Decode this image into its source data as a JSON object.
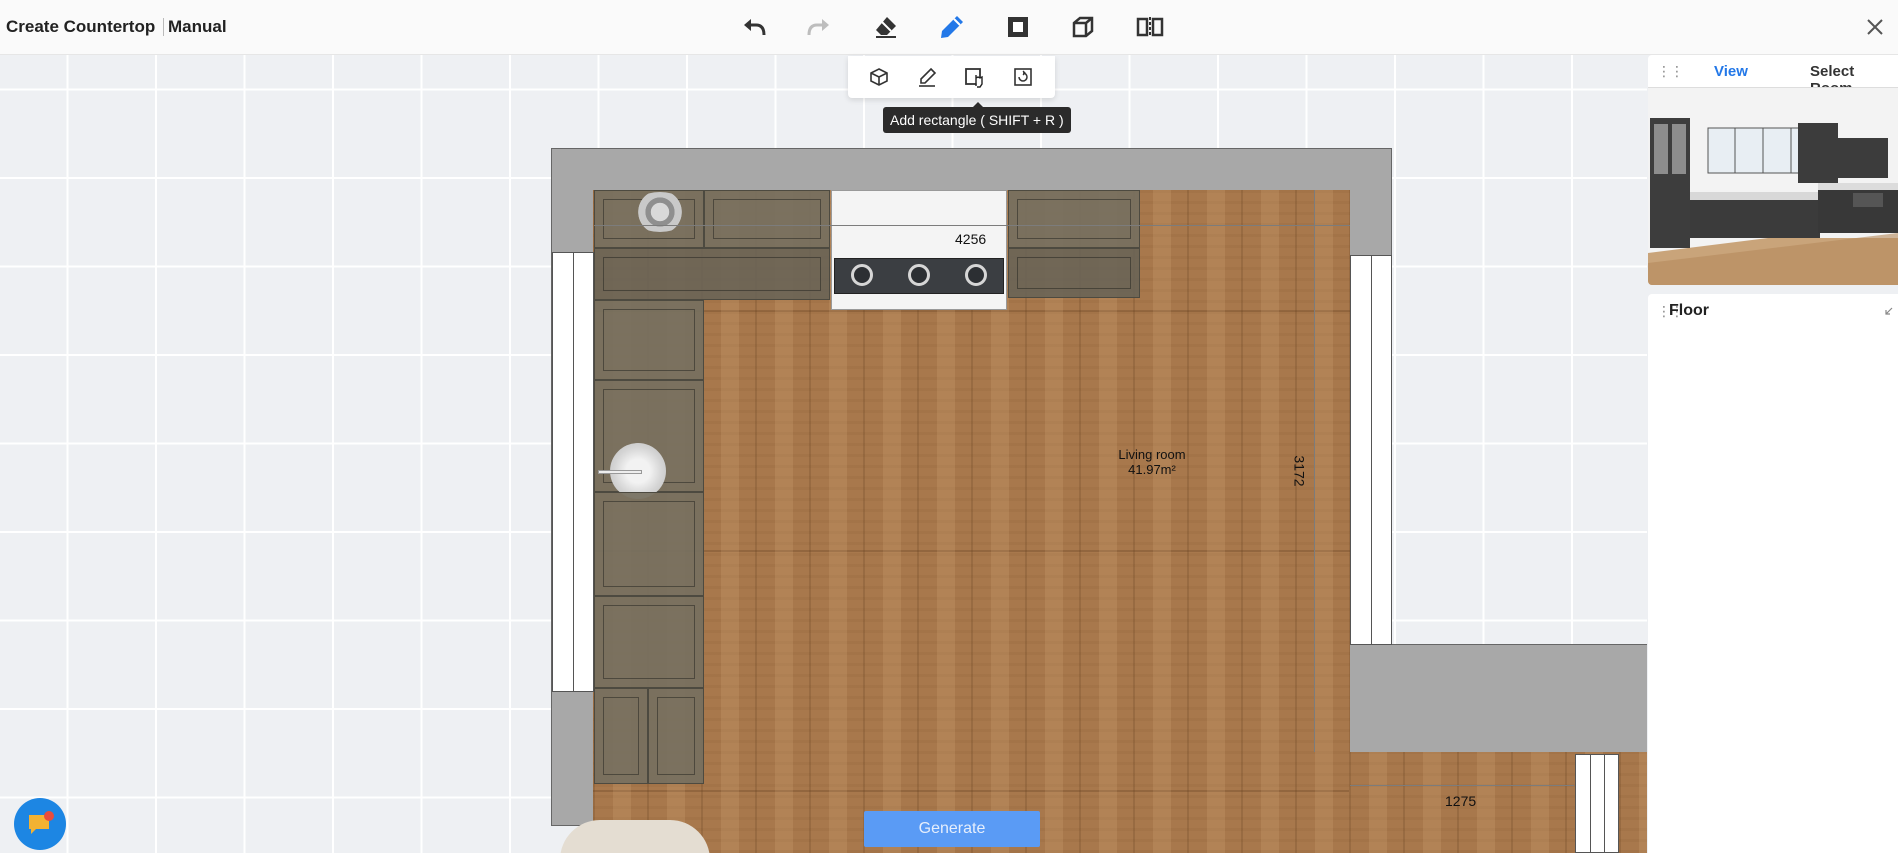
{
  "header": {
    "title": "Create Countertop",
    "mode": "Manual"
  },
  "toolbar": {
    "tools": [
      "undo-icon",
      "redo-icon",
      "eraser-icon",
      "pencil-icon",
      "square-frame-icon",
      "cube-icon",
      "mirror-icon"
    ],
    "active": "pencil-icon",
    "close": "close-icon"
  },
  "subtoolbar": {
    "tools": [
      "box-icon",
      "line-draw-icon",
      "add-rectangle-icon",
      "rotate-square-icon"
    ],
    "tooltip": "Add rectangle ( SHIFT + R )"
  },
  "plan": {
    "dim_top": "4256",
    "dim_right": "3172",
    "dim_bottom_right": "1275",
    "room_name": "Living room",
    "room_area": "41.97m²"
  },
  "generate_label": "Generate",
  "right_panel": {
    "tab_view": "View",
    "tab_select_room": "Select Room",
    "active_tab": "View",
    "floor_title": "Floor"
  },
  "colors": {
    "accent": "#2378e8",
    "generate_bg": "#5a9bf5",
    "wall": "#a8a8a8",
    "floor": "#a8784c"
  }
}
